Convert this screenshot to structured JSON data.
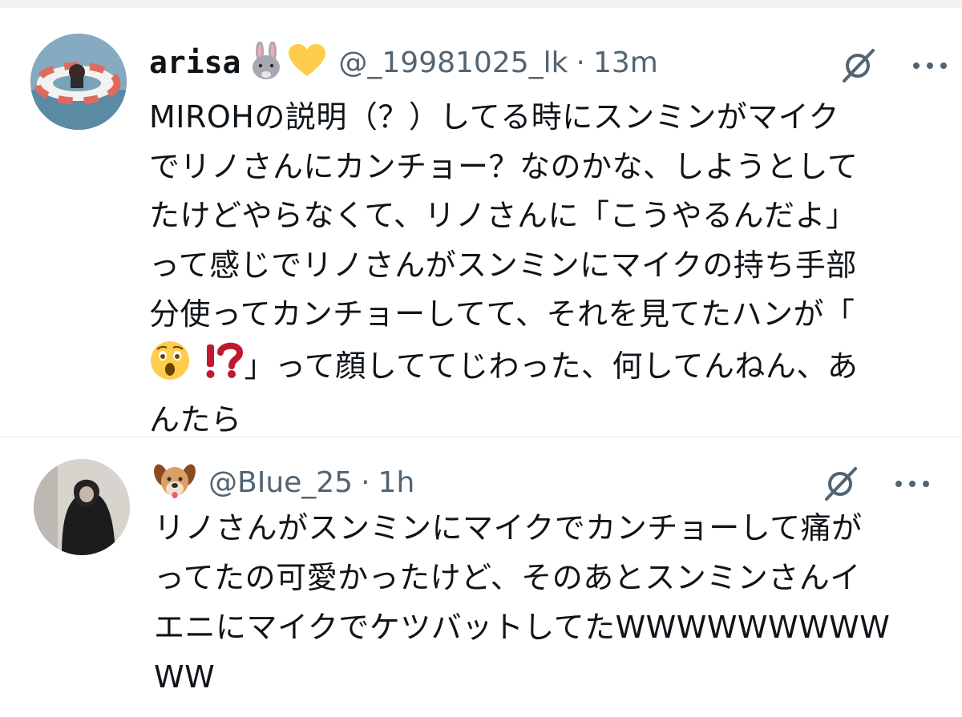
{
  "tweets": [
    {
      "display_name": "arisa",
      "name_emojis": [
        "rabbit-face",
        "yellow-heart"
      ],
      "handle": "@_19981025_lk",
      "separator": "·",
      "time": "13m",
      "lines": [
        "MIROHの説明（？）してる時にスンミンがマイク",
        "でリノさんにカンチョー？なのかな、しようとして",
        "たけどやらなくて、リノさんに「こうやるんだよ」",
        "って感じでリノさんがスンミンにマイクの持ち手部",
        "分使ってカンチョーしてて、それを見てたハンが「",
        "」って顔しててじわった、何してんねん、あ",
        "んたら"
      ],
      "inline_emojis": [
        "astonished-face",
        "exclamation-question-mark"
      ]
    },
    {
      "display_name": "",
      "name_emojis": [
        "dog-face"
      ],
      "handle": "@BIue_25",
      "separator": "·",
      "time": "1h",
      "lines": [
        "リノさんがスンミンにマイクでカンチョーして痛が",
        "ってたの可愛かったけど、そのあとスンミンさんイ",
        "エニにマイクでケツバットしてたWWWWWWWWW",
        "WW"
      ]
    }
  ],
  "colors": {
    "text": "#0f1419",
    "secondary": "#536471",
    "divider": "#eff3f4",
    "heart": "#ffcc4d"
  }
}
